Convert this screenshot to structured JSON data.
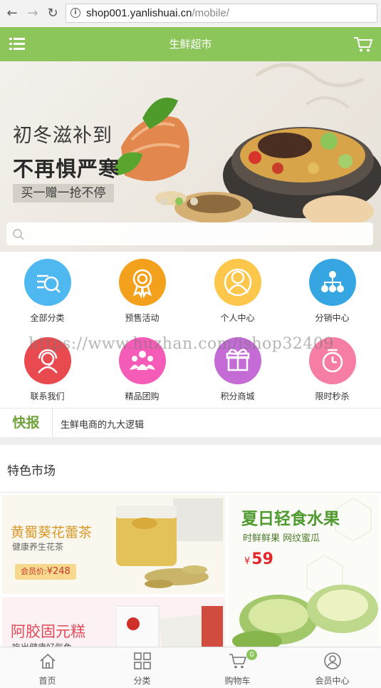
{
  "browser": {
    "url_host": "shop001.yanlishuai.cn",
    "url_path": "/mobile/"
  },
  "header": {
    "title": "生鲜超市"
  },
  "banner": {
    "line1": "初冬滋补到",
    "line2": "不再惧严寒",
    "line3": "买一赠一抢不停",
    "active_dot": 2
  },
  "grid": [
    {
      "label": "全部分类",
      "color": "#4fb8f1"
    },
    {
      "label": "预售活动",
      "color": "#f3a11c"
    },
    {
      "label": "个人中心",
      "color": "#fcc74b"
    },
    {
      "label": "分销中心",
      "color": "#36a6e2"
    },
    {
      "label": "联系我们",
      "color": "#e84a4f"
    },
    {
      "label": "精品团购",
      "color": "#f45cb7"
    },
    {
      "label": "积分商城",
      "color": "#c46bd5"
    },
    {
      "label": "限时秒杀",
      "color": "#f67da4"
    }
  ],
  "watermark": "https://www.huzhan.com/ishop32409",
  "news": {
    "tag": "快报",
    "headline": "生鲜电商的九大逻辑"
  },
  "featured": {
    "title": "特色市场",
    "card1": {
      "title": "黄蜀葵花蕾茶",
      "subtitle": "健康养生花茶",
      "price_label": "会员价:",
      "price": "¥248"
    },
    "card2": {
      "title": "阿胶固元糕",
      "subtitle": "吃出健康好气色"
    },
    "card3": {
      "title": "夏日轻食水果",
      "subtitle": "时鲜鲜果 网纹蜜瓜",
      "price_symbol": "¥",
      "price": "59"
    }
  },
  "tabbar": [
    {
      "label": "首页"
    },
    {
      "label": "分类"
    },
    {
      "label": "购物车",
      "badge": "0"
    },
    {
      "label": "会员中心"
    }
  ],
  "colors": {
    "brand": "#8cc65b",
    "news_tag": "#6fa33a",
    "price_red": "#e2262c"
  }
}
